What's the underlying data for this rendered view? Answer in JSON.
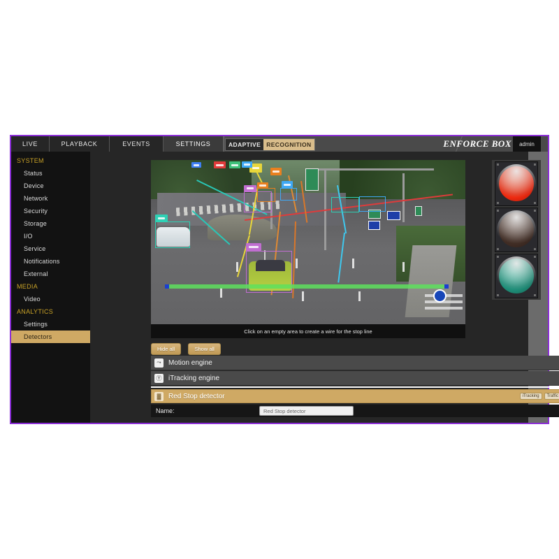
{
  "window": {
    "border_color": "#8b2fd6",
    "background": "#1f1f1f"
  },
  "topbar": {
    "tabs": [
      {
        "id": "live",
        "label": "LIVE",
        "active": false
      },
      {
        "id": "playback",
        "label": "PLAYBACK",
        "active": false
      },
      {
        "id": "events",
        "label": "EVENTS",
        "active": false
      },
      {
        "id": "settings",
        "label": "SETTINGS",
        "active": true
      }
    ],
    "logo": {
      "part1": "ADAPTIVE",
      "part2": "RECOGNITION",
      "part1_color": "#2b2b2b",
      "part2_color": "#d9bd8b"
    },
    "product_name": "ENFORCE BOX",
    "user": "admin"
  },
  "sidebar": {
    "groups": [
      {
        "label": "SYSTEM",
        "items": [
          {
            "label": "Status",
            "active": false
          },
          {
            "label": "Device",
            "active": false
          },
          {
            "label": "Network",
            "active": false
          },
          {
            "label": "Security",
            "active": false
          },
          {
            "label": "Storage",
            "active": false
          },
          {
            "label": "I/O",
            "active": false
          },
          {
            "label": "Service",
            "active": false
          },
          {
            "label": "Notifications",
            "active": false
          },
          {
            "label": "External",
            "active": false
          }
        ]
      },
      {
        "label": "MEDIA",
        "items": [
          {
            "label": "Video",
            "active": false
          }
        ]
      },
      {
        "label": "ANALYTICS",
        "items": [
          {
            "label": "Settings",
            "active": false
          },
          {
            "label": "Detectors",
            "active": true
          }
        ]
      }
    ],
    "active_color": "#cfa964",
    "group_color": "#c9a227"
  },
  "video": {
    "hint": "Click on an empty area to create a wire for the stop line",
    "stop_line": {
      "color": "#5ee05e",
      "handle_color": "#1a3fd0"
    },
    "wires": [
      {
        "name": "teal-wire",
        "color": "#29c7b7"
      },
      {
        "name": "red-wire",
        "color": "#e03b3b"
      },
      {
        "name": "yellow-wire",
        "color": "#e8d63a"
      },
      {
        "name": "orange-wire-1",
        "color": "#e08a33"
      },
      {
        "name": "orange-wire-2",
        "color": "#d9772a"
      },
      {
        "name": "cyan-wire",
        "color": "#3fc8ee"
      }
    ],
    "tracked_objects": [
      {
        "name": "white-suv",
        "color": "#2fd1b5"
      },
      {
        "name": "green-sportscar",
        "color": "#c06ed0"
      },
      {
        "name": "dark-sedan",
        "color": "#e8801f"
      },
      {
        "name": "silver-car",
        "color": "#3fa9f5"
      },
      {
        "name": "blue-van",
        "color": "#3f7ff5"
      },
      {
        "name": "red-truck",
        "color": "#e03b3b"
      },
      {
        "name": "green-car",
        "color": "#3fc07a"
      }
    ]
  },
  "traffic_light": {
    "lamps": [
      {
        "name": "red-lamp",
        "state": "on",
        "color": "#f03018"
      },
      {
        "name": "amber-lamp",
        "state": "off",
        "color": "#4a342a"
      },
      {
        "name": "green-lamp",
        "state": "dim",
        "color": "#239a86"
      }
    ]
  },
  "controls": {
    "hide_all": "Hide all",
    "show_all": "Show all"
  },
  "engines": [
    {
      "label": "Motion engine",
      "icon": "motion-icon",
      "glyph": "⤳"
    },
    {
      "label": "iTracking engine",
      "icon": "tracking-icon",
      "glyph": "Ⓣ"
    }
  ],
  "detector": {
    "label": "Red Stop detector",
    "icon": "traffic-light-icon",
    "glyph": "▓",
    "badges": [
      "iTracking",
      "Traffic"
    ],
    "accent": "#cfa964"
  },
  "form": {
    "name_label": "Name:",
    "name_value": "Red Stop detector"
  }
}
